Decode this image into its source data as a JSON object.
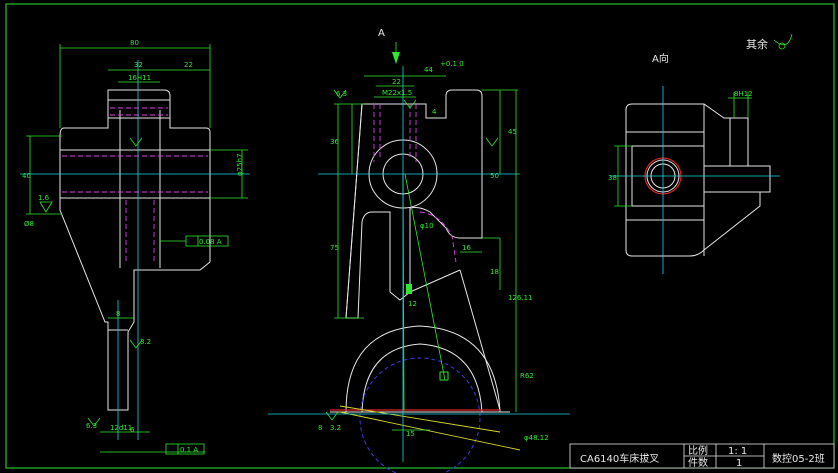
{
  "drawing": {
    "view_a_marker": "A",
    "view_a_label": "A向",
    "other_surfaces_note": "其余",
    "dims_left": {
      "overall_width": "80",
      "top_32": "32",
      "top_22": "22",
      "bore": "16H11",
      "height_40": "40",
      "phi": "φ25h7",
      "ra_16": "1.6",
      "ra_32": "3.2",
      "ra_63": "6.3",
      "phi_small": "Ø8",
      "flat": "0.08 A",
      "bottom_12": "12d11",
      "bottom_6": "6",
      "flat_bottom": "0.1 A",
      "w8": "8"
    },
    "dims_mid": {
      "top_44": "44",
      "top_44_tol": "+0.1 0",
      "m_thread": "M22x1.5",
      "d22": "22",
      "d4": "4",
      "d36": "36",
      "d45": "45",
      "d50": "50",
      "d75": "75",
      "d16": "16",
      "d18": "18",
      "d126": "126.11",
      "phi10": "φ10",
      "d12": "12",
      "d15": "15",
      "r62": "R62",
      "d8": "8",
      "phi_arc": "φ48.12",
      "ra_mid": "6.3",
      "ra_mid2": "3.2"
    },
    "dims_right": {
      "b4": "8H12",
      "d38": "38"
    }
  },
  "title_block": {
    "part_name": "CA6140车床拔叉",
    "scale_label": "比例",
    "scale_value": "1: 1",
    "qty_label": "件数",
    "qty_value": "1",
    "class_label": "数控05-2班"
  }
}
